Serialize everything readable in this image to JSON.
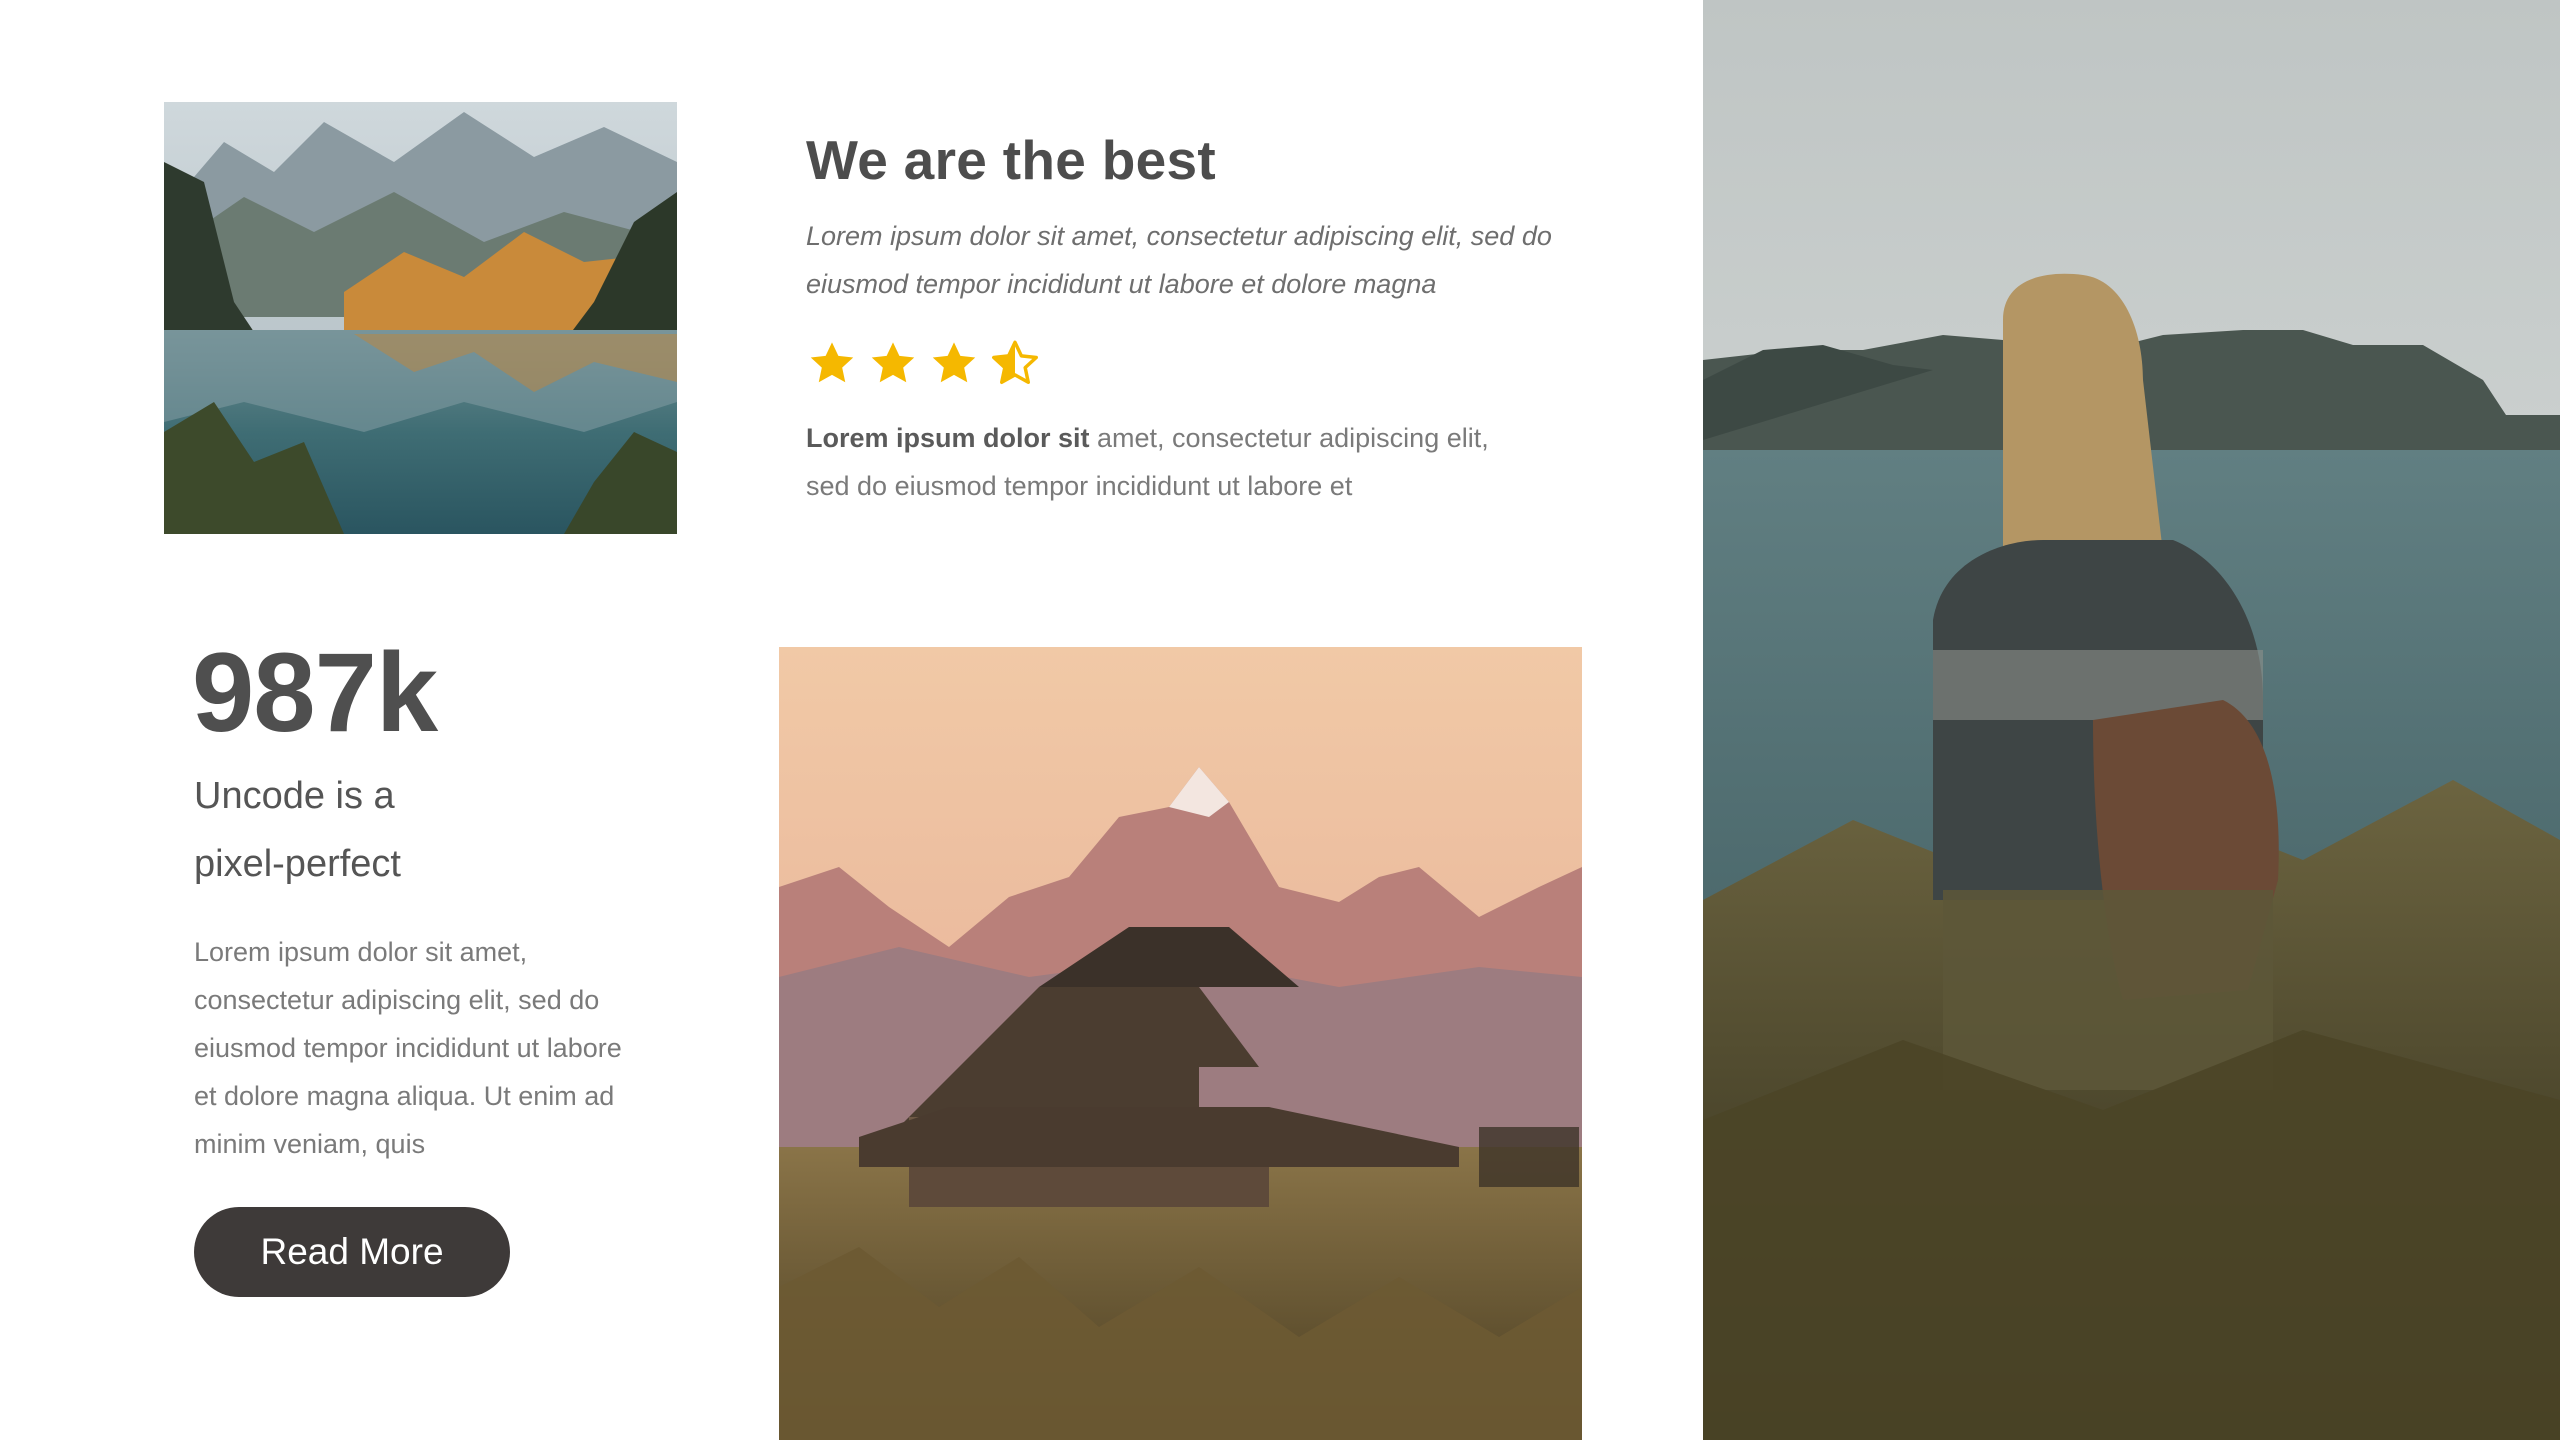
{
  "feature": {
    "title": "We are the best",
    "intro_line1": "Lorem ipsum dolor sit amet, consectetur adipiscing elit, sed do",
    "intro_line2": "eiusmod tempor incididunt ut labore et dolore magna",
    "rating": {
      "value": 3.5,
      "max": 4,
      "color": "#f5b800"
    },
    "detail_bold": "Lorem ipsum dolor sit",
    "detail_rest": " amet, consectetur adipiscing elit,",
    "detail_line2": "sed do eiusmod tempor incididunt ut labore et"
  },
  "stats": {
    "number": "987k",
    "tagline_line1": "Uncode is a",
    "tagline_line2": "pixel-perfect",
    "body_lines": [
      "Lorem ipsum dolor sit amet,",
      "consectetur adipiscing elit, sed do",
      "eiusmod tempor incididunt ut labore",
      "et dolore magna aliqua. Ut enim ad",
      "minim veniam, quis"
    ],
    "button_label": "Read More",
    "button_color": "#3e3a39"
  },
  "images": {
    "lake": "mountain-lake-photo",
    "barn": "barn-mountains-photo",
    "woman": "woman-by-sea-photo"
  }
}
